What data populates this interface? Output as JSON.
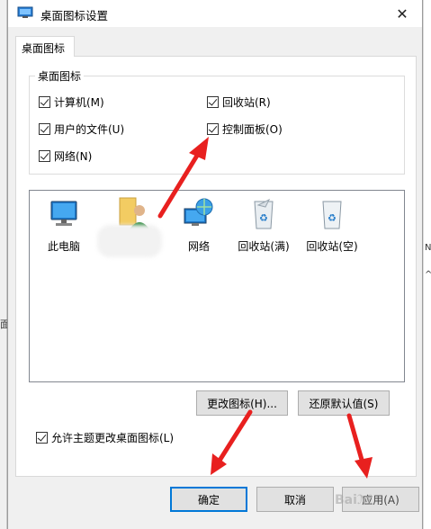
{
  "window": {
    "title": "桌面图标设置",
    "close_glyph": "✕"
  },
  "tab": {
    "label": "桌面图标"
  },
  "group": {
    "legend": "桌面图标",
    "checkboxes": [
      {
        "label": "计算机(M)",
        "checked": true
      },
      {
        "label": "回收站(R)",
        "checked": true
      },
      {
        "label": "用户的文件(U)",
        "checked": true
      },
      {
        "label": "控制面板(O)",
        "checked": true
      },
      {
        "label": "网络(N)",
        "checked": true
      }
    ]
  },
  "icons": [
    {
      "label": "此电脑",
      "icon": "computer-icon"
    },
    {
      "label": "",
      "icon": "user-folder-icon"
    },
    {
      "label": "网络",
      "icon": "network-icon"
    },
    {
      "label": "回收站(满)",
      "icon": "recycle-bin-full-icon"
    },
    {
      "label": "回收站(空)",
      "icon": "recycle-bin-empty-icon"
    }
  ],
  "buttons": {
    "change_icon": "更改图标(H)...",
    "restore_default": "还原默认值(S)",
    "ok": "确定",
    "cancel": "取消",
    "apply": "应用(A)"
  },
  "allow_theme": {
    "label": "允许主题更改桌面图标(L)",
    "checked": true
  },
  "background_fragments": {
    "right_1": "Ν",
    "right_2": "^",
    "left_1": "面"
  },
  "colors": {
    "accent": "#0078d7",
    "arrow": "#e8201f"
  }
}
